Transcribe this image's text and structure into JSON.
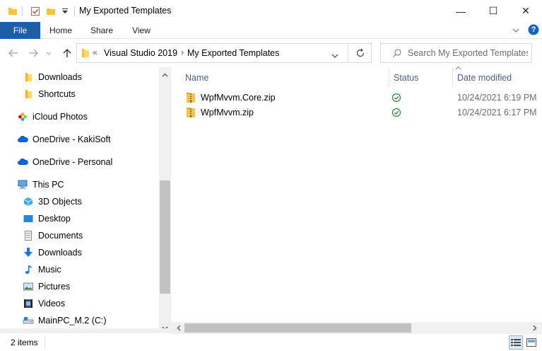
{
  "window": {
    "title": "My Exported Templates",
    "minimize_glyph": "—",
    "maximize_glyph": "☐",
    "close_glyph": "✕"
  },
  "ribbon": {
    "tabs": [
      {
        "label": "File"
      },
      {
        "label": "Home"
      },
      {
        "label": "Share"
      },
      {
        "label": "View"
      }
    ],
    "help_glyph": "?"
  },
  "address": {
    "overflow": "«",
    "breadcrumbs": [
      "Visual Studio 2019",
      "My Exported Templates"
    ],
    "separator": "›"
  },
  "search": {
    "placeholder": "Search My Exported Templates"
  },
  "navpane": {
    "items": [
      {
        "label": "Downloads",
        "icon": "folder-icon"
      },
      {
        "label": "Shortcuts",
        "icon": "folder-icon"
      },
      {
        "label": "iCloud Photos",
        "icon": "icloud-photos-icon"
      },
      {
        "label": "OneDrive - KakiSoft",
        "icon": "onedrive-icon"
      },
      {
        "label": "OneDrive - Personal",
        "icon": "onedrive-icon"
      },
      {
        "label": "This PC",
        "icon": "computer-icon"
      },
      {
        "label": "3D Objects",
        "icon": "cube-icon"
      },
      {
        "label": "Desktop",
        "icon": "desktop-icon"
      },
      {
        "label": "Documents",
        "icon": "documents-icon"
      },
      {
        "label": "Downloads",
        "icon": "download-arrow-icon"
      },
      {
        "label": "Music",
        "icon": "music-note-icon"
      },
      {
        "label": "Pictures",
        "icon": "pictures-icon"
      },
      {
        "label": "Videos",
        "icon": "videos-icon"
      },
      {
        "label": "MainPC_M.2 (C:)",
        "icon": "drive-icon"
      }
    ]
  },
  "columns": {
    "name": "Name",
    "status": "Status",
    "date_modified": "Date modified"
  },
  "files": [
    {
      "name": "WpfMvvm.Core.zip",
      "date": "10/24/2021 6:19 PM",
      "status_icon": "synced-check-icon"
    },
    {
      "name": "WpfMvvm.zip",
      "date": "10/24/2021 6:17 PM",
      "status_icon": "synced-check-icon"
    }
  ],
  "statusbar": {
    "item_count": "2 items"
  },
  "colors": {
    "file_tab": "#1d5fa7",
    "folder": "#f6c342",
    "column_header": "#4d6082",
    "sync_green": "#2a8a3a",
    "help_blue": "#1565c0"
  }
}
